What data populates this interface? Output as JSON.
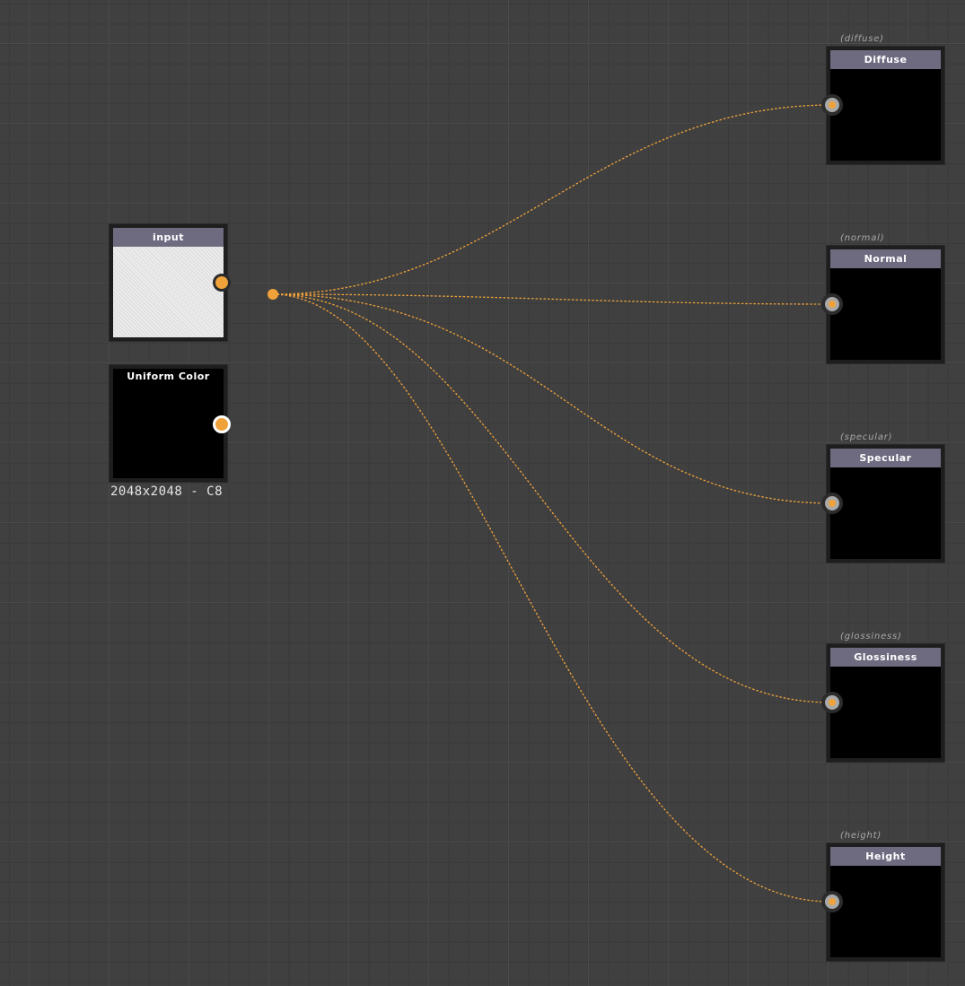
{
  "graph": {
    "input_node": {
      "title": "input"
    },
    "uniform_node": {
      "title": "Uniform Color",
      "caption": "2048x2048 - C8"
    },
    "outputs": [
      {
        "label": "(diffuse)",
        "title": "Diffuse"
      },
      {
        "label": "(normal)",
        "title": "Normal"
      },
      {
        "label": "(specular)",
        "title": "Specular"
      },
      {
        "label": "(glossiness)",
        "title": "Glossiness"
      },
      {
        "label": "(height)",
        "title": "Height"
      }
    ]
  },
  "colors": {
    "background": "#404040",
    "wire": "#f0a23a",
    "header": "#6e6b80",
    "port": "#f0a23a"
  },
  "icons": {
    "port": "circle-port-icon",
    "junction": "dot-icon"
  }
}
